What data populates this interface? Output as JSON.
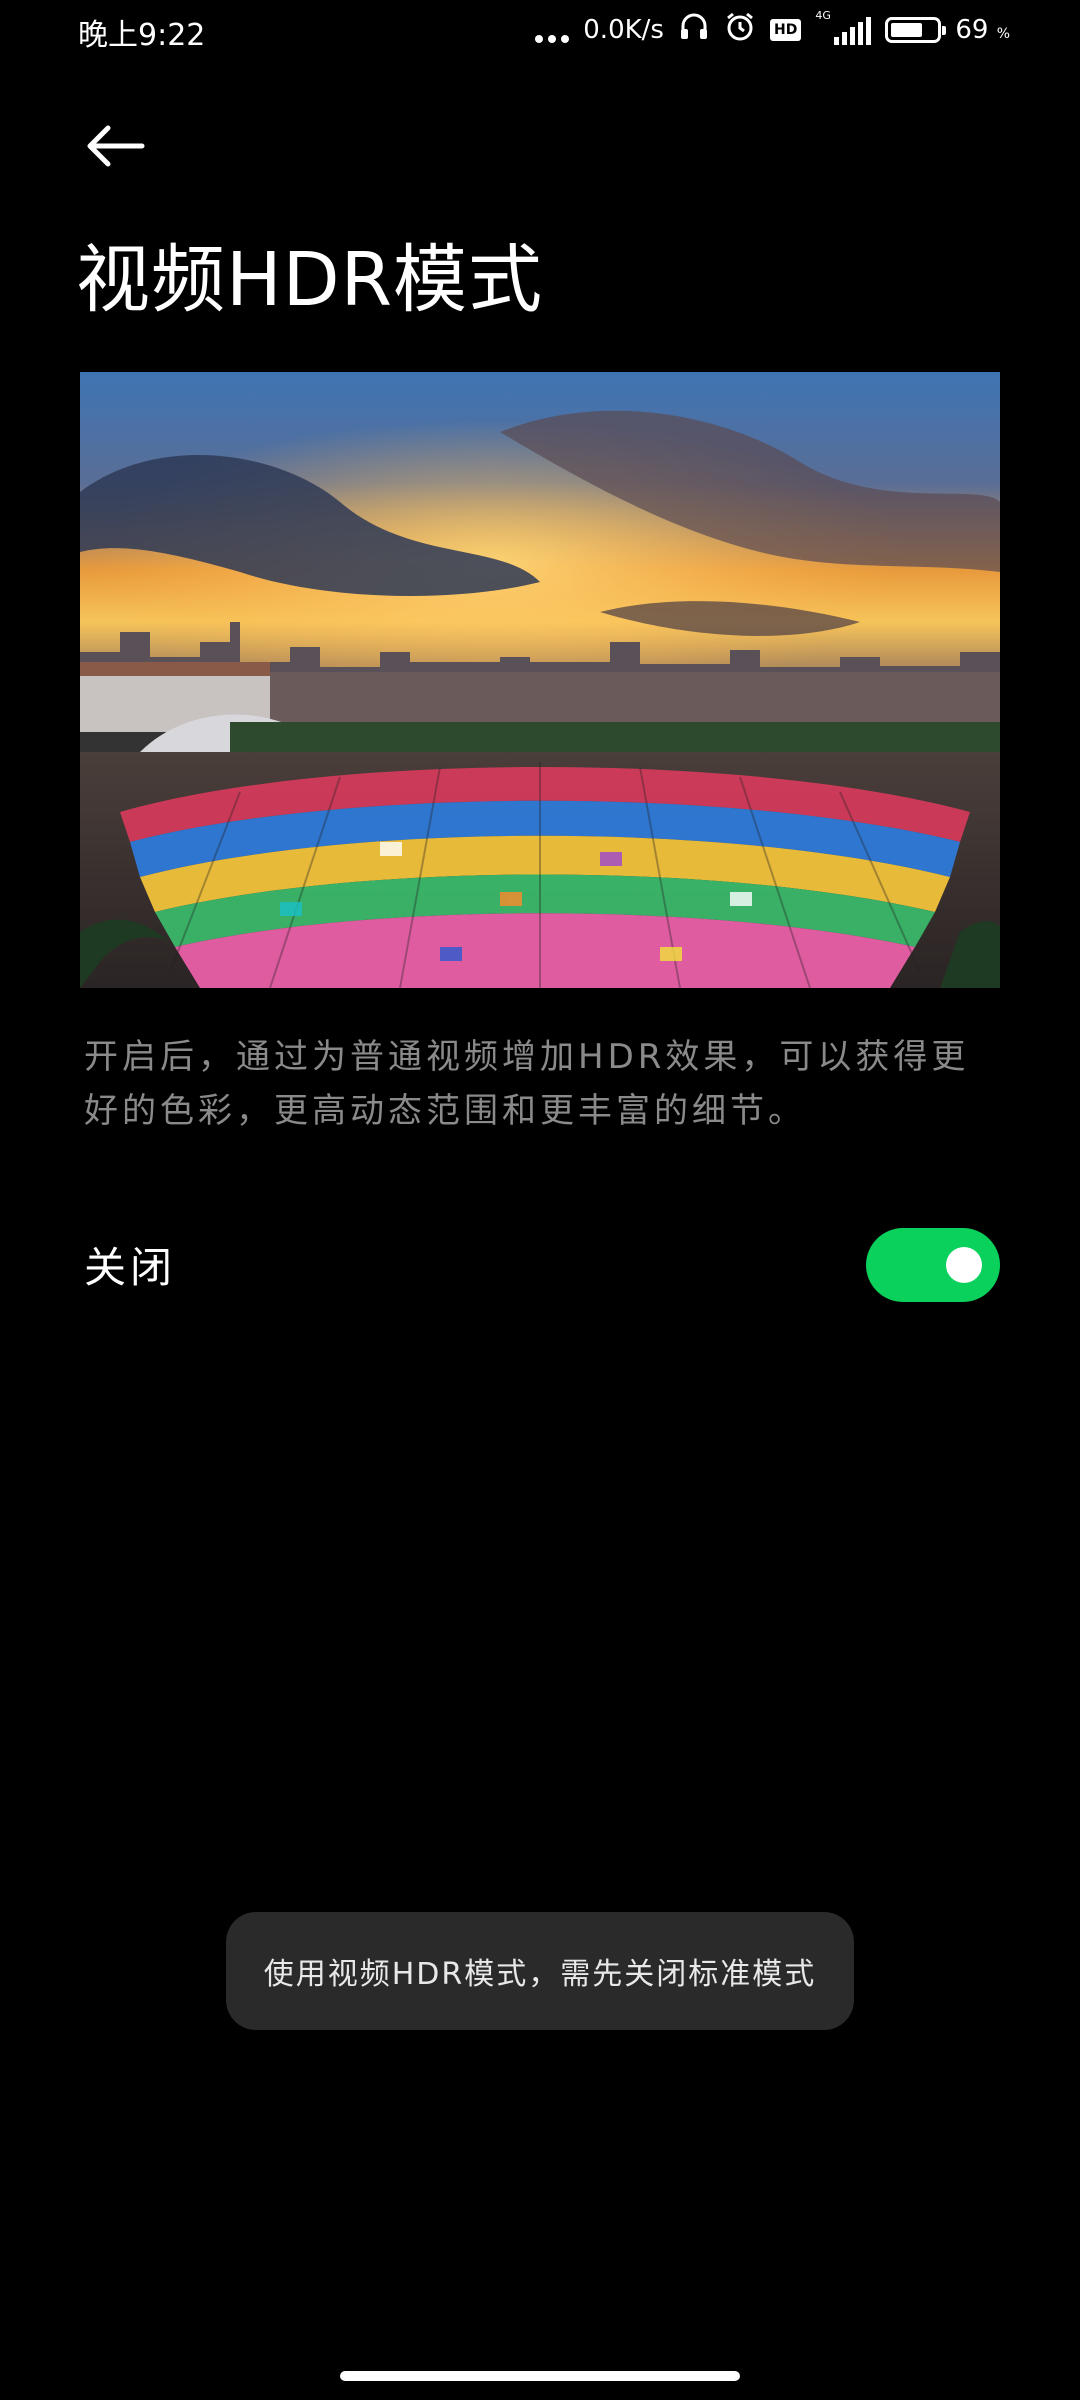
{
  "status_bar": {
    "time": "晚上9:22",
    "network_speed": "0.0K/s",
    "hd_badge": "HD",
    "network_type": "4G",
    "battery_percent": "69",
    "battery_unit": "%"
  },
  "header": {
    "title": "视频HDR模式"
  },
  "main": {
    "description": "开启后，通过为普通视频增加HDR效果，可以获得更好的色彩，更高动态范围和更丰富的细节。",
    "setting": {
      "label": "关闭",
      "toggle_on": true
    }
  },
  "toast": {
    "message": "使用视频HDR模式，需先关闭标准模式"
  },
  "colors": {
    "accent": "#0ad15c",
    "background": "#000000",
    "secondary_text": "#8a8a8a",
    "toast_bg": "#2a2a2a"
  },
  "icons": {
    "back": "arrow-left-icon",
    "headphones": "headphones-icon",
    "alarm": "alarm-icon",
    "signal": "signal-icon",
    "battery": "battery-icon"
  }
}
